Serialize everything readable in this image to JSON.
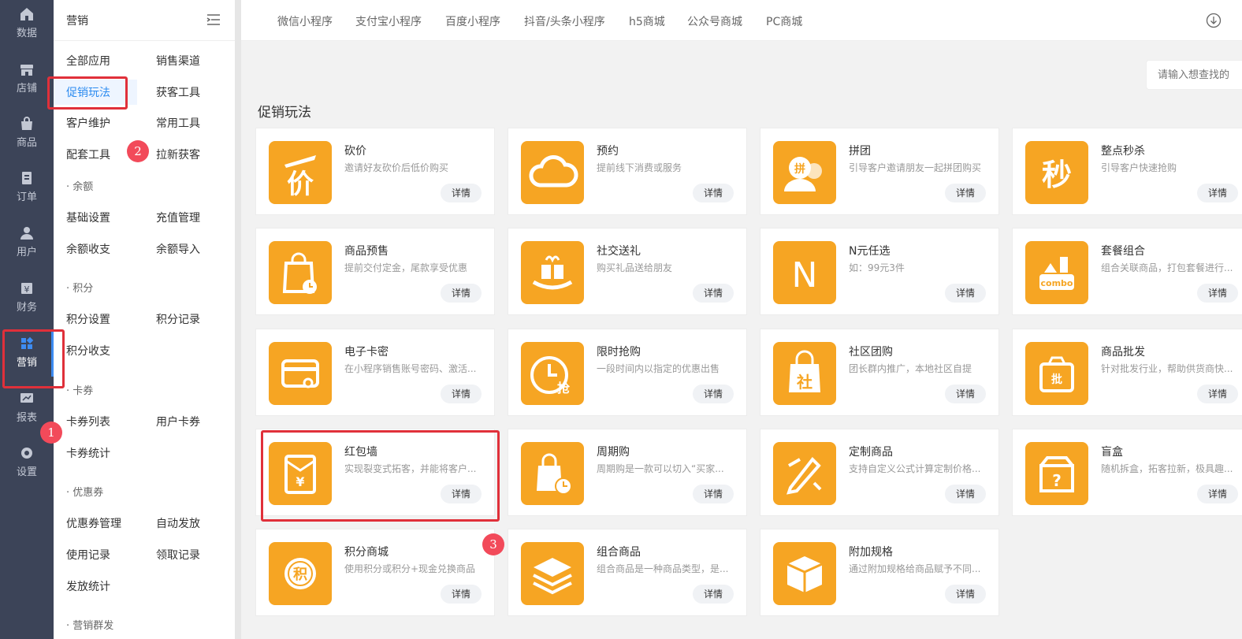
{
  "rail": [
    {
      "label": "数据",
      "icon": "home-icon"
    },
    {
      "label": "店铺",
      "icon": "store-icon"
    },
    {
      "label": "商品",
      "icon": "bag-icon"
    },
    {
      "label": "订单",
      "icon": "order-icon"
    },
    {
      "label": "用户",
      "icon": "user-icon"
    },
    {
      "label": "财务",
      "icon": "finance-icon"
    },
    {
      "label": "营销",
      "icon": "marketing-icon",
      "active": true
    },
    {
      "label": "报表",
      "icon": "report-icon"
    },
    {
      "label": "设置",
      "icon": "gear-icon"
    }
  ],
  "sidebar": {
    "title": "营销",
    "links": {
      "all_apps": "全部应用",
      "sales_channel": "销售渠道",
      "promo": "促销玩法",
      "acquisition": "获客工具",
      "customer_care": "客户维护",
      "common_tools": "常用工具",
      "support_tools": "配套工具",
      "new_customers": "拉新获客",
      "balance_settings": "基础设置",
      "recharge_mgmt": "充值管理",
      "balance_flow": "余额收支",
      "balance_import": "余额导入",
      "points_settings": "积分设置",
      "points_records": "积分记录",
      "points_flow": "积分收支",
      "coupon_list": "卡券列表",
      "user_coupons": "用户卡券",
      "coupon_stats": "卡券统计",
      "voucher_mgmt": "优惠券管理",
      "auto_issue": "自动发放",
      "usage_records": "使用记录",
      "claim_records": "领取记录",
      "issue_stats": "发放统计"
    },
    "groups": {
      "balance": "· 余额",
      "points": "· 积分",
      "coupons": "· 卡券",
      "vouchers": "· 优惠券",
      "mass": "· 营销群发"
    }
  },
  "tabs": [
    "微信小程序",
    "支付宝小程序",
    "百度小程序",
    "抖音/头条小程序",
    "h5商城",
    "公众号商城",
    "PC商城"
  ],
  "search": {
    "placeholder": "请输入想查找的"
  },
  "section_title": "促销玩法",
  "detail_label": "详情",
  "cards": [
    {
      "name": "砍价",
      "desc": "邀请好友砍价后低价购买",
      "icon": "bargain-icon"
    },
    {
      "name": "预约",
      "desc": "提前线下消费或服务",
      "icon": "cloud-icon"
    },
    {
      "name": "拼团",
      "desc": "引导客户邀请朋友一起拼团购买",
      "icon": "group-buy-icon"
    },
    {
      "name": "整点秒杀",
      "desc": "引导客户快速抢购",
      "icon": "flash-sale-icon"
    },
    {
      "name": "商品预售",
      "desc": "提前交付定金，尾款享受优惠",
      "icon": "presale-icon"
    },
    {
      "name": "社交送礼",
      "desc": "购买礼品送给朋友",
      "icon": "gift-icon"
    },
    {
      "name": "N元任选",
      "desc": "如：99元3件",
      "icon": "n-yuan-icon"
    },
    {
      "name": "套餐组合",
      "desc": "组合关联商品，打包套餐进行...",
      "icon": "combo-icon"
    },
    {
      "name": "电子卡密",
      "desc": "在小程序销售账号密码、激活...",
      "icon": "e-card-icon"
    },
    {
      "name": "限时抢购",
      "desc": "一段时间内以指定的优惠出售",
      "icon": "limited-time-icon"
    },
    {
      "name": "社区团购",
      "desc": "团长群内推广，本地社区自提",
      "icon": "community-icon"
    },
    {
      "name": "商品批发",
      "desc": "针对批发行业，帮助供货商快...",
      "icon": "wholesale-icon"
    },
    {
      "name": "红包墙",
      "desc": "实现裂变式拓客，并能将客户...",
      "icon": "red-packet-icon"
    },
    {
      "name": "周期购",
      "desc": "周期购是一款可以切入“买家...",
      "icon": "periodic-icon"
    },
    {
      "name": "定制商品",
      "desc": "支持自定义公式计算定制价格...",
      "icon": "custom-icon"
    },
    {
      "name": "盲盒",
      "desc": "随机拆盒，拓客拉新，极具趣...",
      "icon": "blind-box-icon"
    },
    {
      "name": "积分商城",
      "desc": "使用积分或积分+现金兑换商品",
      "icon": "points-mall-icon"
    },
    {
      "name": "组合商品",
      "desc": "组合商品是一种商品类型，是...",
      "icon": "layers-icon"
    },
    {
      "name": "附加规格",
      "desc": "通过附加规格给商品赋予不同...",
      "icon": "package-icon"
    }
  ],
  "annotations": [
    "1",
    "2",
    "3"
  ],
  "colors": {
    "accent": "#f6a523",
    "rail": "#3c4458",
    "highlight": "#e0303a",
    "active_link": "#2d8cf0"
  }
}
